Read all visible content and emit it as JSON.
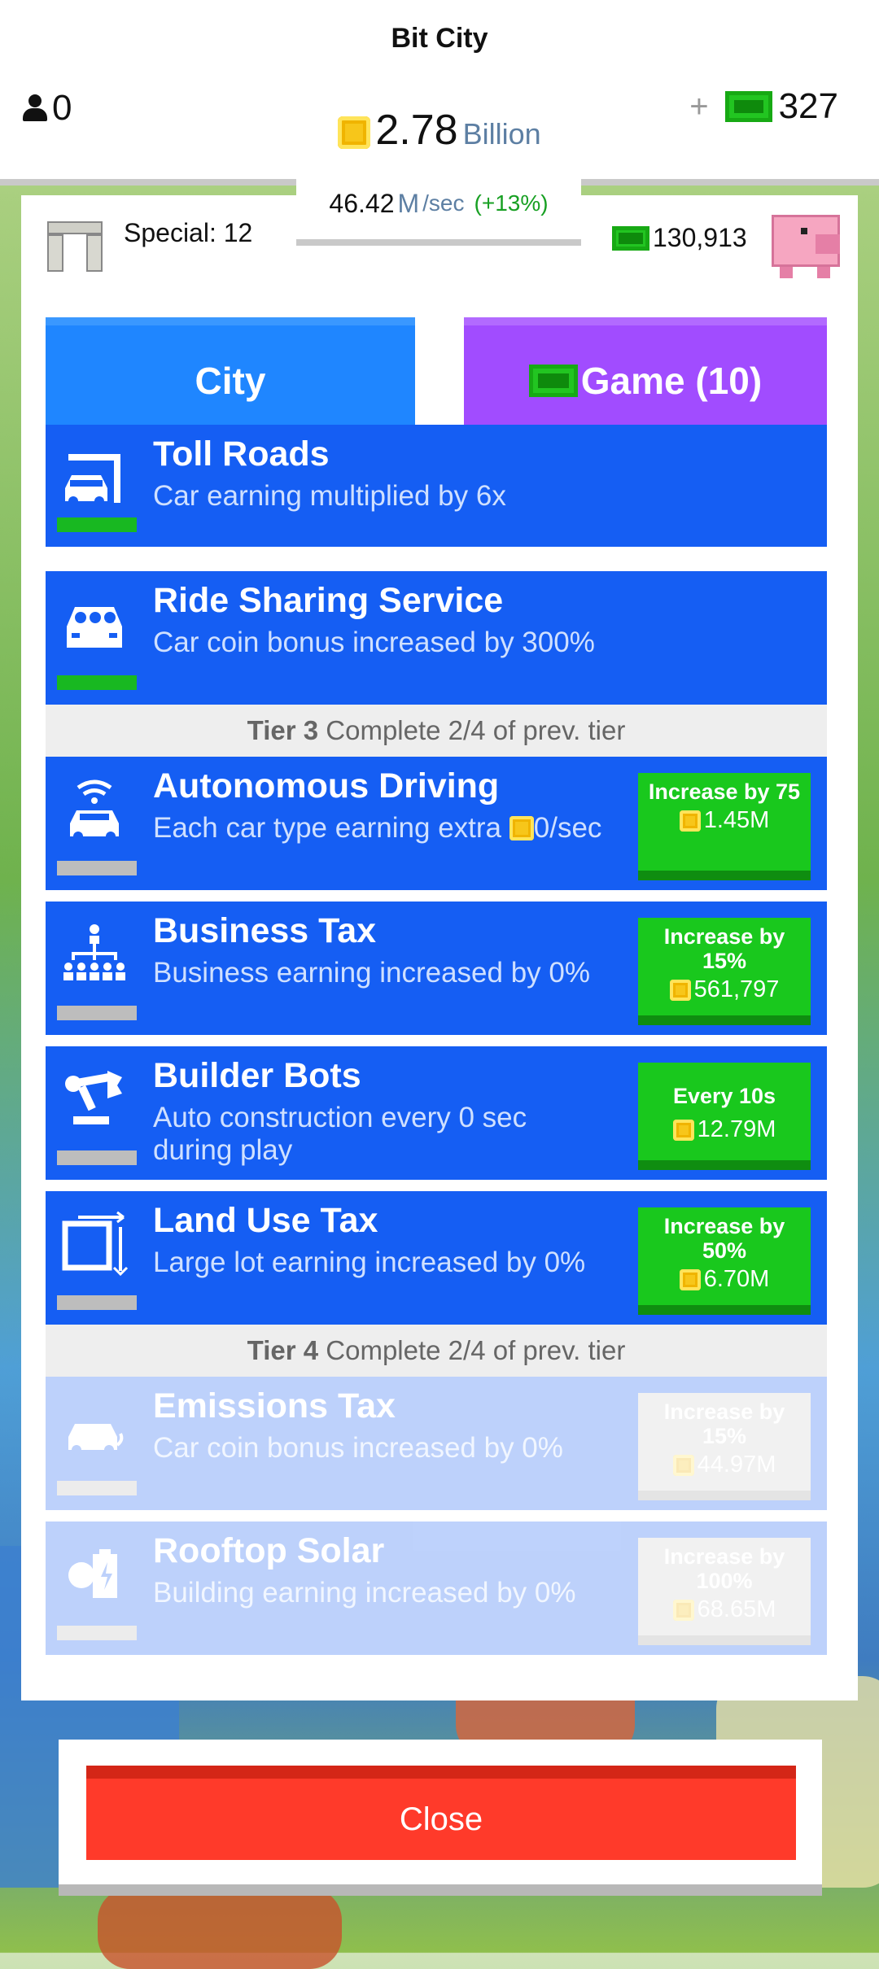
{
  "header": {
    "title": "Bit City",
    "population": "0",
    "coins": {
      "value": "2.78",
      "unit": "Billion"
    },
    "cash": "327",
    "plus": "+",
    "rate": {
      "value": "46.42",
      "unit": "M",
      "per": "/sec",
      "bonus": "(+13%)"
    }
  },
  "special": {
    "label": "Special: 12"
  },
  "piggy_bank": {
    "cash": "130,913"
  },
  "tabs": [
    {
      "label": "City",
      "selected": true
    },
    {
      "label": "Game (10)",
      "selected": false
    }
  ],
  "upgrades": [
    {
      "title": "Toll Roads",
      "desc": "Car earning multiplied by 6x",
      "icon": "toll-gate-icon",
      "complete": true
    },
    {
      "title": "Ride Sharing Service",
      "desc": "Car coin bonus increased by 300%",
      "icon": "car-front-icon",
      "complete": true
    }
  ],
  "tier3": {
    "label": "Tier 3",
    "req": "Complete 2/4 of prev. tier"
  },
  "tier3_items": [
    {
      "title": "Autonomous Driving",
      "desc_pre": "Each car type earning extra",
      "desc_post": "0/sec",
      "buy_label": "Increase by 75",
      "price": "1.45M",
      "icon": "wifi-car-icon"
    },
    {
      "title": "Business Tax",
      "desc": "Business earning increased by 0%",
      "buy_label": "Increase by 15%",
      "price": "561,797",
      "icon": "org-chart-icon"
    },
    {
      "title": "Builder Bots",
      "desc": "Auto construction every 0 sec during play",
      "buy_label": "Every 10s",
      "price": "12.79M",
      "icon": "robot-arm-icon"
    },
    {
      "title": "Land Use Tax",
      "desc": "Large lot earning increased by 0%",
      "buy_label": "Increase by 50%",
      "price": "6.70M",
      "icon": "land-plot-icon"
    }
  ],
  "tier4": {
    "label": "Tier 4",
    "req": "Complete 2/4 of prev. tier"
  },
  "tier4_items": [
    {
      "title": "Emissions Tax",
      "desc": "Car coin bonus increased by 0%",
      "buy_label": "Increase by 15%",
      "price": "44.97M",
      "icon": "emissions-car-icon"
    },
    {
      "title": "Rooftop Solar",
      "desc": "Building earning increased by 0%",
      "buy_label": "Increase by 100%",
      "price": "68.65M",
      "icon": "solar-battery-icon"
    }
  ],
  "close": {
    "label": "Close"
  },
  "colors": {
    "row_blue": "#155ef3",
    "buy_green": "#19c81d",
    "tab_city": "#1f86ff",
    "tab_game": "#a14cff",
    "close_red": "#ff3a2a"
  }
}
